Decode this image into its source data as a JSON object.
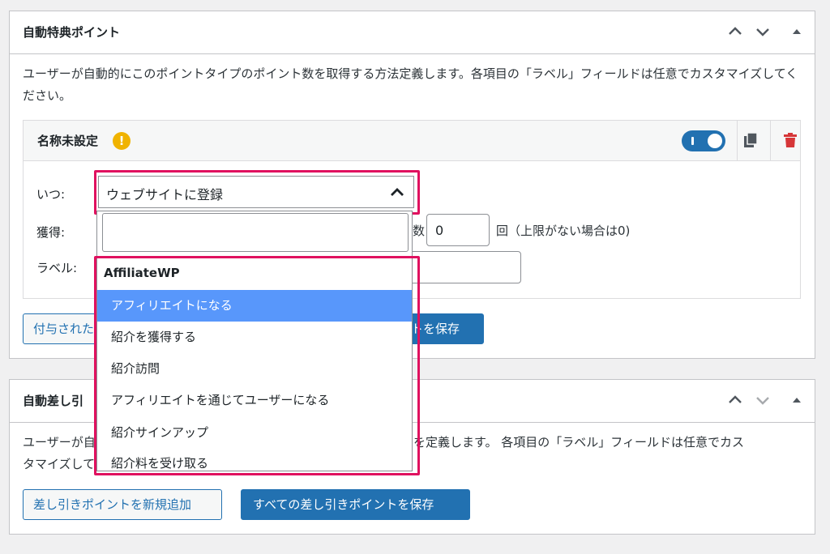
{
  "earn_box": {
    "title": "自動特典ポイント",
    "description": "ユーザーが自動的にこのポイントタイプのポイント数を取得する方法定義します。各項目の「ラベル」フィールドは任意でカスタマイズしてください。",
    "item": {
      "name": "名称未設定",
      "warning_glyph": "!",
      "toggle_enabled": true,
      "fields": {
        "when_label": "いつ:",
        "earn_label": "獲得:",
        "label_label": "ラベル:",
        "limit_prefix": "数",
        "limit_value": "0",
        "limit_suffix": "回（上限がない場合は0)",
        "label_value": ""
      }
    },
    "add_button": "付与された",
    "save_button": "トを保存"
  },
  "dropdown": {
    "selected": "ウェブサイトに登録",
    "search_value": "",
    "group": "AffiliateWP",
    "options": [
      {
        "label": "アフィリエイトになる",
        "active": true
      },
      {
        "label": "紹介を獲得する",
        "active": false
      },
      {
        "label": "紹介訪問",
        "active": false
      },
      {
        "label": "アフィリエイトを通じてユーザーになる",
        "active": false
      },
      {
        "label": "紹介サインアップ",
        "active": false
      },
      {
        "label": "紹介料を受け取る",
        "active": false
      }
    ]
  },
  "deduct_box": {
    "title": "自動差し引",
    "description_left_1": "ユーザーが自",
    "description_right_1": "を定義します。 各項目の「ラベル」フィールドは任意でカス",
    "description_left_2": "タマイズして",
    "add_button": "差し引きポイントを新規追加",
    "save_button": "すべての差し引きポイントを保存"
  },
  "colors": {
    "accent": "#2271b1",
    "highlight_frame": "#e0115f",
    "warning": "#f0b300",
    "delete": "#d63638",
    "option_active": "#5897fb"
  }
}
